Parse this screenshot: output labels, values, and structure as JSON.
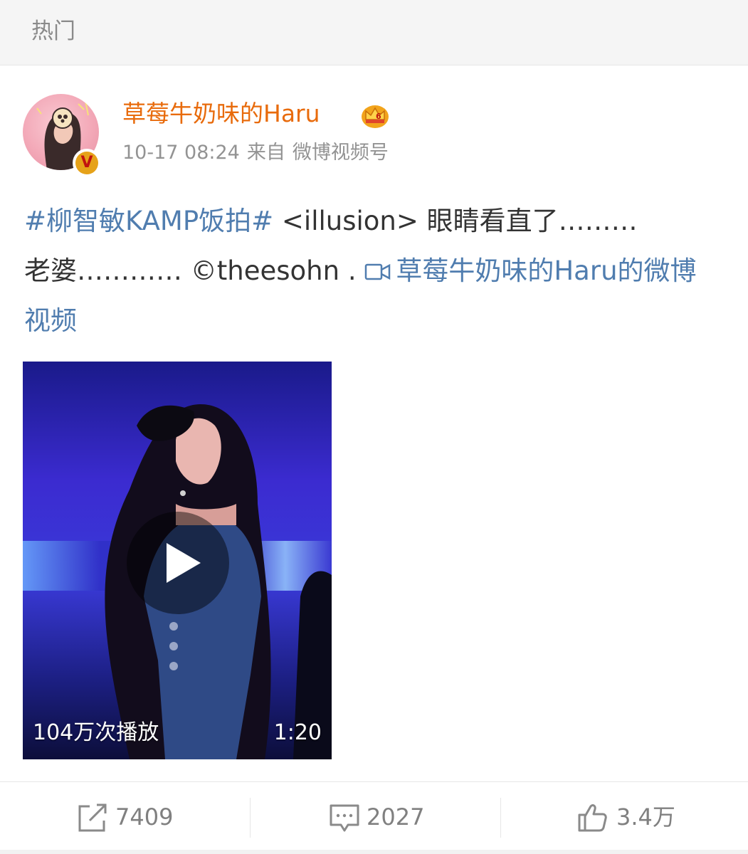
{
  "topbar": {
    "label": "热门"
  },
  "post": {
    "username": "草莓牛奶味的Haru",
    "timestamp": "10-17 08:24",
    "source_prefix": "来自",
    "source": "微博视频号",
    "badge_letter": "V",
    "text": {
      "hashtag": "#柳智敏KAMP饭拍#",
      "body_1": " <illusion> 眼睛看直了………",
      "body_2": "老婆………… ©theesohn . ",
      "video_link": "草莓牛奶味的Haru的微博视频"
    },
    "video": {
      "view_count": "104万次播放",
      "duration": "1:20"
    }
  },
  "actions": {
    "repost_count": "7409",
    "comment_count": "2027",
    "like_count": "3.4万"
  },
  "icons": {
    "crown": "crown-icon",
    "video_link": "video-camera-icon",
    "play": "play-icon",
    "repost": "repost-icon",
    "comment": "comment-icon",
    "like": "thumbs-up-icon"
  },
  "colors": {
    "username": "#e86b0c",
    "link": "#507daf",
    "text": "#333333",
    "meta": "#939393",
    "action": "#808080"
  }
}
